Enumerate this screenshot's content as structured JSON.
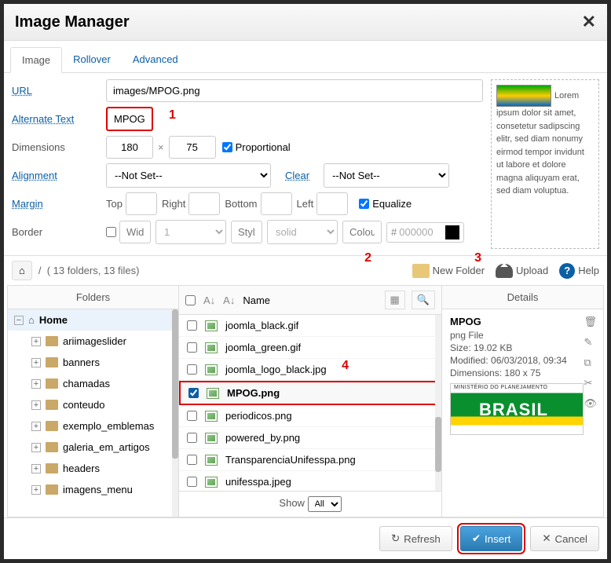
{
  "header": {
    "title": "Image Manager"
  },
  "tabs": {
    "image": "Image",
    "rollover": "Rollover",
    "advanced": "Advanced"
  },
  "form": {
    "url_label": "URL",
    "url_value": "images/MPOG.png",
    "alt_label": "Alternate Text",
    "alt_value": "MPOG",
    "dim_label": "Dimensions",
    "dim_w": "180",
    "dim_h": "75",
    "prop_label": "Proportional",
    "align_label": "Alignment",
    "align_value": "--Not Set--",
    "clear_label": "Clear",
    "clear_value": "--Not Set--",
    "margin_label": "Margin",
    "top": "Top",
    "right": "Right",
    "bottom": "Bottom",
    "left": "Left",
    "equalize": "Equalize",
    "border_label": "Border",
    "width_ph": "Width",
    "style_num": "1",
    "style_ph": "Style",
    "style_val": "solid",
    "colour_ph": "Colour",
    "colour_val": "000000"
  },
  "preview": {
    "text": "Lorem ipsum dolor sit amet, consetetur sadipscing elitr, sed diam nonumy eirmod tempor invidunt ut labore et dolore magna aliquyam erat, sed diam voluptua."
  },
  "toolbar": {
    "path": "( 13 folders, 13 files)",
    "new_folder": "New Folder",
    "upload": "Upload",
    "help": "Help"
  },
  "folders": {
    "head": "Folders",
    "home": "Home",
    "items": [
      "ariimageslider",
      "banners",
      "chamadas",
      "conteudo",
      "exemplo_emblemas",
      "galeria_em_artigos",
      "headers",
      "imagens_menu"
    ]
  },
  "files": {
    "name_head": "Name",
    "items": [
      "joomla_black.gif",
      "joomla_green.gif",
      "joomla_logo_black.jpg",
      "MPOG.png",
      "periodicos.png",
      "powered_by.png",
      "TransparenciaUnifesspa.png",
      "unifesspa.jpeg"
    ],
    "selected_index": 3,
    "show": "Show",
    "show_val": "All"
  },
  "details": {
    "head": "Details",
    "title": "MPOG",
    "type": "png File",
    "size": "Size: 19.02 KB",
    "modified": "Modified: 06/03/2018, 09:34",
    "dimensions": "Dimensions: 180 x 75"
  },
  "annotations": {
    "a1": "1",
    "a2": "2",
    "a3": "3",
    "a4": "4"
  },
  "footer": {
    "refresh": "Refresh",
    "insert": "Insert",
    "cancel": "Cancel"
  }
}
